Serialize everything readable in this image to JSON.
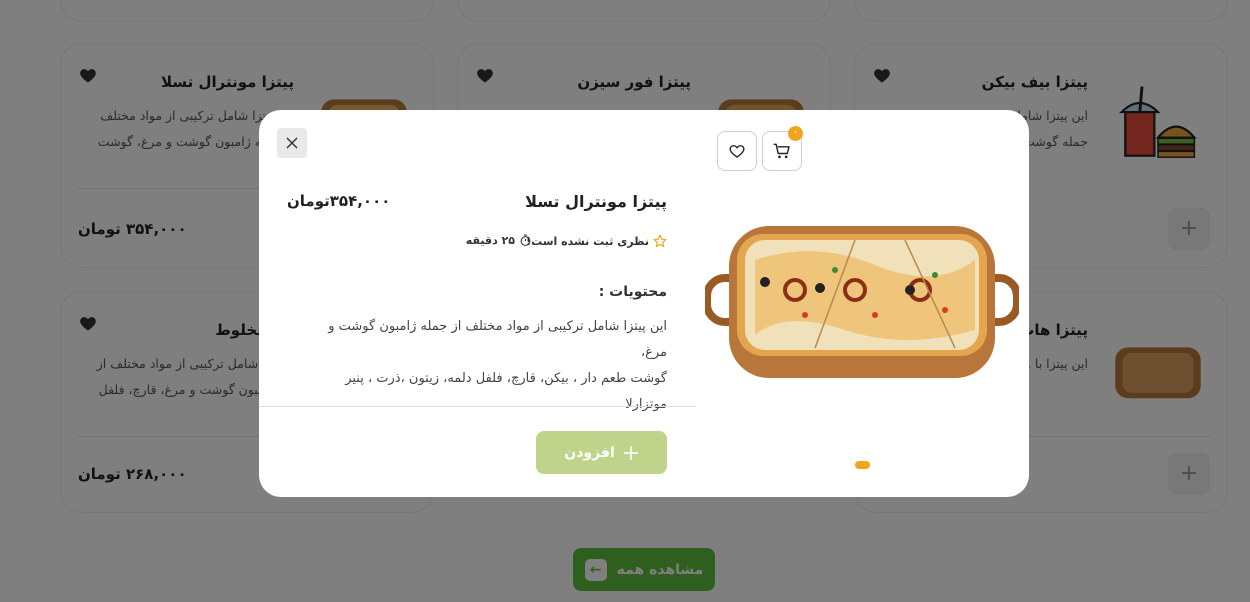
{
  "background": {
    "cards": [
      {
        "title": "پیتزا بیف بیکن",
        "desc": "این پیتزا شامل ترکیبی از مواد مختلف از جمله گوشت..."
      },
      {
        "title": "پیتزا فور سیزن",
        "desc": ""
      },
      {
        "title": "پیتزا مونترال تسلا",
        "desc": "این پیتزا شامل ترکیبی از مواد مختلف از جمله ژامبون گوشت و مرغ، گوشت طعم...",
        "price": "۳۵۴,۰۰۰ تومان"
      },
      {
        "title": "پیتزا هات داگ",
        "desc": "این پیتزا با ... شامل پیتزا ..."
      },
      {
        "title": "پیتزا مخلوط",
        "desc": "این پیتزا شامل ترکیبی از مواد مختلف از جمله ژامبون گوشت و مرغ، قارچ، فلفل ...",
        "price": "۲۶۸,۰۰۰ تومان"
      }
    ],
    "plus": "+",
    "see_all": "مشاهده همه",
    "see_all_arrow": "←"
  },
  "modal": {
    "close_symbol": "×",
    "cart_count": "۰",
    "product_name": "پیتزا مونترال تسلا",
    "price": "۳۵۴,۰۰۰تومان",
    "rating_text": "نظری ثبت نشده است!",
    "time_text": "۲۵ دقیقه",
    "ingredients_title": "محتویات :",
    "ingredients_line1": "این پیتزا شامل ترکیبی از مواد مختلف از جمله ژامبون گوشت و مرغ،",
    "ingredients_line2": "گوشت طعم دار ، بیکن، قارچ، فلفل دلمه، زیتون ،ذرت ، پنیر موتزارلا",
    "add_label": "افزودن"
  },
  "colors": {
    "accent_green": "#5fbf3e",
    "add_button_disabled": "#bfd48a",
    "badge_orange": "#f0a51a"
  }
}
